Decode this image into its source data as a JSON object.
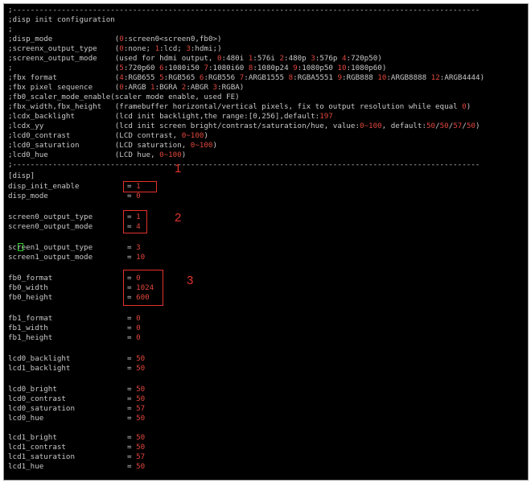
{
  "lines": {
    "l00": ";---------------------------------------------------------------------------------------------------------",
    "l01": ";disp init configuration",
    "l02": ";",
    "l03a": ";disp_mode              (",
    "l03b": "0",
    "l03c": ":screen0<screen0,fb0>)",
    "l04a": ";screenx_output_type    (",
    "l04b": "0",
    "l04c": ":none; ",
    "l04d": "1",
    "l04e": ":lcd; ",
    "l04f": "3",
    "l04g": ":hdmi;)",
    "l05a": ";screenx_output_mode    (used for hdmi output, ",
    "l05b": "0",
    "l05c": ":480i ",
    "l05d": "1",
    "l05e": ":576i ",
    "l05f": "2",
    "l05g": ":480p ",
    "l05h": "3",
    "l05i": ":576p ",
    "l05j": "4",
    "l05k": ":720p50)",
    "l06a": ";                       (",
    "l06b": "5",
    "l06c": ":720p60 ",
    "l06d": "6",
    "l06e": ":1080i50 ",
    "l06f": "7",
    "l06g": ":1080i60 ",
    "l06h": "8",
    "l06i": ":1080p24 ",
    "l06j": "9",
    "l06k": ":1080p50 ",
    "l06l": "10",
    "l06m": ":1080p60)",
    "l07a": ";fbx format             (",
    "l07b": "4",
    "l07c": ":RGB655 ",
    "l07d": "5",
    "l07e": ":RGB565 ",
    "l07f": "6",
    "l07g": ":RGB556 ",
    "l07h": "7",
    "l07i": ":ARGB1555 ",
    "l07j": "8",
    "l07k": ":RGBA5551 ",
    "l07l": "9",
    "l07m": ":RGB888 ",
    "l07n": "10",
    "l07o": ":ARGB8888 ",
    "l07p": "12",
    "l07q": ":ARGB4444)",
    "l08a": ";fbx pixel sequence     (",
    "l08b": "0",
    "l08c": ":ARGB ",
    "l08d": "1",
    "l08e": ":BGRA ",
    "l08f": "2",
    "l08g": ":ABGR ",
    "l08h": "3",
    "l08i": ":RGBA)",
    "l09": ";fb0_scaler_mode_enable(scaler mode enable, used FE)",
    "l10a": ";fbx_width,fbx_height   (framebuffer horizontal/vertical pixels, fix to output resolution while equal ",
    "l10b": "0",
    "l10c": ")",
    "l11a": ";lcdx_backlight         (lcd init backlight,the range:[0,256],default:",
    "l11b": "197",
    "l12a": ";lcdx_yy                (lcd init screen bright/contrast/saturation/hue, value:",
    "l12b": "0~100",
    "l12c": ", default:",
    "l12d": "50",
    "l12e": "/",
    "l12f": "50",
    "l12g": "/",
    "l12h": "57",
    "l12i": "/",
    "l12j": "50",
    "l12k": ")",
    "l13a": ";lcd0_contrast          (LCD contrast, ",
    "l13b": "0~100",
    "l13c": ")",
    "l14a": ";lcd0_saturation        (LCD saturation, ",
    "l14b": "0~100",
    "l14c": ")",
    "l15a": ";lcd0_hue               (LCD hue, ",
    "l15b": "0~100",
    "l15c": ")",
    "l16": ";---------------------------------------------------------------------------------------------------------",
    "l17": "[disp]"
  },
  "settings": {
    "disp_init_enable": {
      "key": "disp_init_enable",
      "value": "1"
    },
    "disp_mode": {
      "key": "disp_mode",
      "value": "0"
    },
    "screen0_output_type": {
      "key": "screen0_output_type",
      "value": "1"
    },
    "screen0_output_mode": {
      "key": "screen0_output_mode",
      "value": "4"
    },
    "screen1_output_type": {
      "key": "screen1_output_type",
      "value": "3"
    },
    "screen1_output_mode": {
      "key": "screen1_output_mode",
      "value": "10"
    },
    "fb0_format": {
      "key": "fb0_format",
      "value": "0"
    },
    "fb0_width": {
      "key": "fb0_width",
      "value": "1024"
    },
    "fb0_height": {
      "key": "fb0_height",
      "value": "600"
    },
    "fb1_format": {
      "key": "fb1_format",
      "value": "0"
    },
    "fb1_width": {
      "key": "fb1_width",
      "value": "0"
    },
    "fb1_height": {
      "key": "fb1_height",
      "value": "0"
    },
    "lcd0_backlight": {
      "key": "lcd0_backlight",
      "value": "50"
    },
    "lcd1_backlight": {
      "key": "lcd1_backlight",
      "value": "50"
    },
    "lcd0_bright": {
      "key": "lcd0_bright",
      "value": "50"
    },
    "lcd0_contrast": {
      "key": "lcd0_contrast",
      "value": "50"
    },
    "lcd0_saturation": {
      "key": "lcd0_saturation",
      "value": "57"
    },
    "lcd0_hue": {
      "key": "lcd0_hue",
      "value": "50"
    },
    "lcd1_bright": {
      "key": "lcd1_bright",
      "value": "50"
    },
    "lcd1_contrast": {
      "key": "lcd1_contrast",
      "value": "50"
    },
    "lcd1_saturation": {
      "key": "lcd1_saturation",
      "value": "57"
    },
    "lcd1_hue": {
      "key": "lcd1_hue",
      "value": "50"
    }
  },
  "eq": "= ",
  "annotations": {
    "a1": "1",
    "a2": "2",
    "a3": "3"
  },
  "colors": {
    "background": "#000000",
    "text": "#c8c8c8",
    "value": "#e0463c",
    "annotation": "#e3322a",
    "cursor": "#33cc33"
  }
}
